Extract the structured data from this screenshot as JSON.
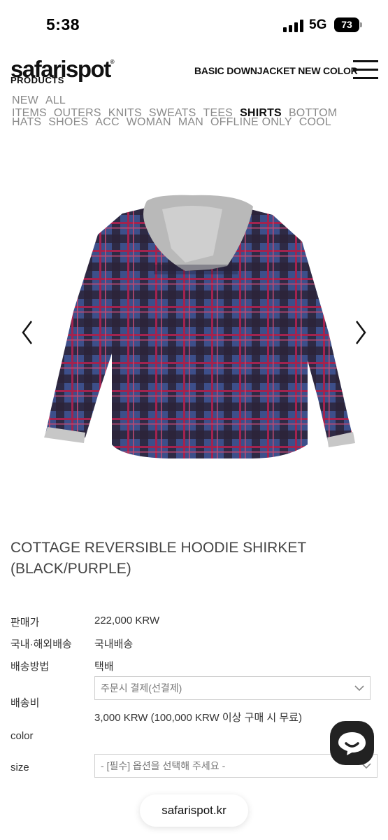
{
  "status_bar": {
    "time": "5:38",
    "network": "5G",
    "battery": "73"
  },
  "header": {
    "logo": "safarispot",
    "logo_mark": "®",
    "section": "PRODUCTS",
    "promo": "BASIC DOWNJACKET NEW COLOR"
  },
  "nav": {
    "row1": [
      "NEW",
      "ALL ITEMS",
      "OUTERS",
      "KNITS",
      "SWEATS",
      "TEES",
      "SHIRTS",
      "BOTTOM"
    ],
    "row2": [
      "HATS",
      "SHOES",
      "ACC",
      "WOMAN",
      "MAN",
      "OFFLINE ONLY",
      "COOL"
    ],
    "active": "SHIRTS"
  },
  "product": {
    "title_line1": "COTTAGE REVERSIBLE HOODIE SHIRKET",
    "title_line2": "(BLACK/PURPLE)",
    "image_icon": "hoodie-shirt-image",
    "colors": {
      "check_dark": "#2b2338",
      "check_blue": "#3d4f8a",
      "check_red": "#a3234f",
      "hood": "#b9b9b9"
    }
  },
  "info": {
    "price_label": "판매가",
    "price_value": "222,000 KRW",
    "shipping_region_label": "국내·해외배송",
    "shipping_region_value": "국내배송",
    "shipping_method_label": "배송방법",
    "shipping_method_value": "택배",
    "shipping_fee_label": "배송비",
    "shipping_fee_select": "주문시 결제(선결제)",
    "shipping_fee_value": "3,000 KRW (100,000 KRW 이상 구매 시 무료)",
    "color_label": "color",
    "size_label": "size",
    "size_select": "- [필수] 옵션을 선택해 주세요 -"
  },
  "footer": {
    "site": "safarispot.kr"
  },
  "icons": {
    "prev": "chevron-left-icon",
    "next": "chevron-right-icon",
    "menu": "hamburger-menu-icon",
    "chat": "chat-bubble-icon"
  }
}
